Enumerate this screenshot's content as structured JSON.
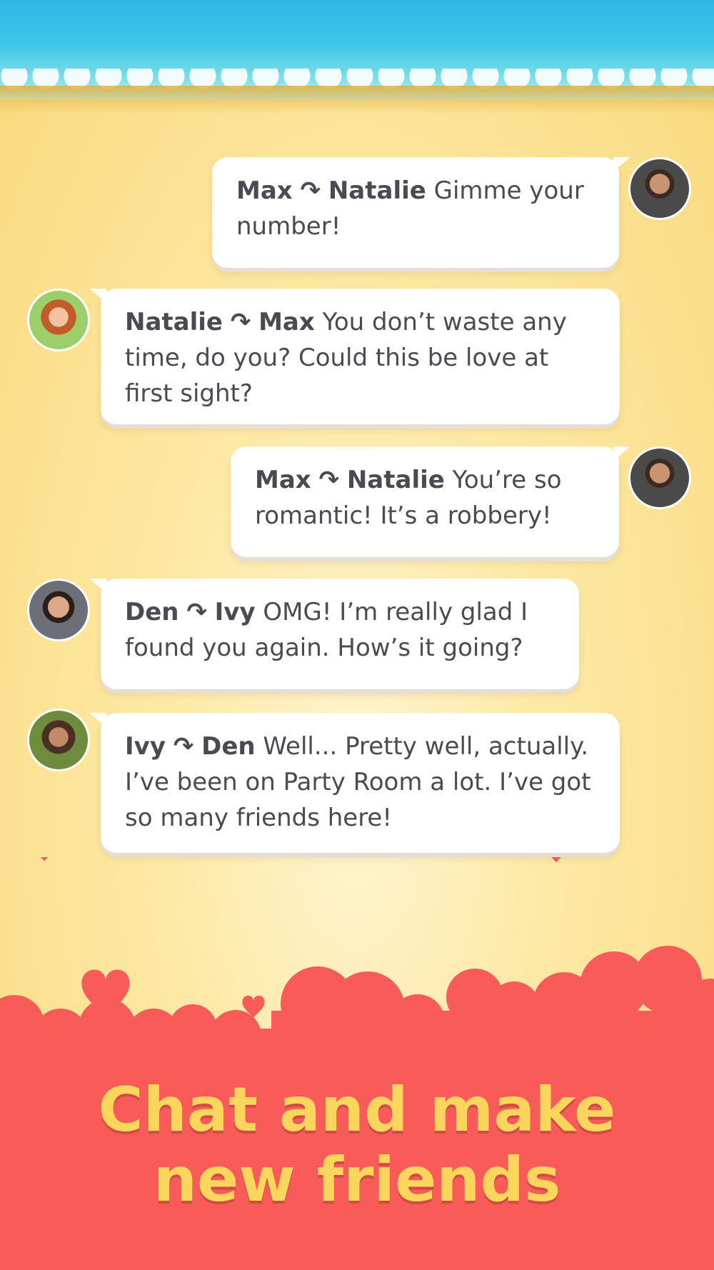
{
  "colors": {
    "background": "#fde9a6",
    "sea": "#2fb6e6",
    "band": "#f85b58",
    "heart": "#f85b58",
    "headline": "#fcd55c",
    "bubble_text": "#4a4a52"
  },
  "messages": [
    {
      "from": "Max",
      "to": "Natalie",
      "text": "Gimme your number!",
      "side": "right",
      "avatar_icon": "max-avatar"
    },
    {
      "from": "Natalie",
      "to": "Max",
      "text": "You don’t waste any time, do you? Could this be love at first sight?",
      "side": "left",
      "avatar_icon": "natalie-avatar"
    },
    {
      "from": "Max",
      "to": "Natalie",
      "text": "You’re so romantic! It’s a robbery!",
      "side": "right",
      "avatar_icon": "max-avatar"
    },
    {
      "from": "Den",
      "to": "Ivy",
      "text": "OMG! I’m really glad I found you again. How’s it going?",
      "side": "left",
      "avatar_icon": "den-avatar"
    },
    {
      "from": "Ivy",
      "to": "Den",
      "text": "Well... Pretty well, actually. I’ve been on Party Room a lot. I’ve got so many friends here!",
      "side": "left",
      "avatar_icon": "ivy-avatar"
    }
  ],
  "arrow_glyph": "↷",
  "headline": "Chat and make\nnew friends"
}
